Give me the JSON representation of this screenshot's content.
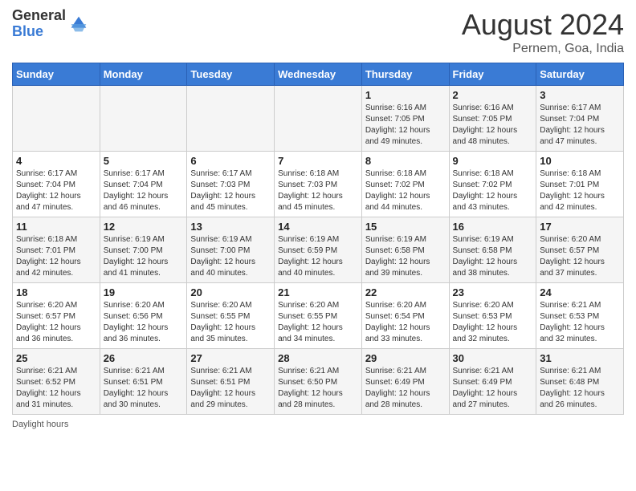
{
  "header": {
    "logo_general": "General",
    "logo_blue": "Blue",
    "main_title": "August 2024",
    "subtitle": "Pernem, Goa, India"
  },
  "days_of_week": [
    "Sunday",
    "Monday",
    "Tuesday",
    "Wednesday",
    "Thursday",
    "Friday",
    "Saturday"
  ],
  "footer": {
    "daylight_hours_label": "Daylight hours"
  },
  "weeks": [
    [
      {
        "day": "",
        "info": ""
      },
      {
        "day": "",
        "info": ""
      },
      {
        "day": "",
        "info": ""
      },
      {
        "day": "",
        "info": ""
      },
      {
        "day": "1",
        "info": "Sunrise: 6:16 AM\nSunset: 7:05 PM\nDaylight: 12 hours\nand 49 minutes."
      },
      {
        "day": "2",
        "info": "Sunrise: 6:16 AM\nSunset: 7:05 PM\nDaylight: 12 hours\nand 48 minutes."
      },
      {
        "day": "3",
        "info": "Sunrise: 6:17 AM\nSunset: 7:04 PM\nDaylight: 12 hours\nand 47 minutes."
      }
    ],
    [
      {
        "day": "4",
        "info": "Sunrise: 6:17 AM\nSunset: 7:04 PM\nDaylight: 12 hours\nand 47 minutes."
      },
      {
        "day": "5",
        "info": "Sunrise: 6:17 AM\nSunset: 7:04 PM\nDaylight: 12 hours\nand 46 minutes."
      },
      {
        "day": "6",
        "info": "Sunrise: 6:17 AM\nSunset: 7:03 PM\nDaylight: 12 hours\nand 45 minutes."
      },
      {
        "day": "7",
        "info": "Sunrise: 6:18 AM\nSunset: 7:03 PM\nDaylight: 12 hours\nand 45 minutes."
      },
      {
        "day": "8",
        "info": "Sunrise: 6:18 AM\nSunset: 7:02 PM\nDaylight: 12 hours\nand 44 minutes."
      },
      {
        "day": "9",
        "info": "Sunrise: 6:18 AM\nSunset: 7:02 PM\nDaylight: 12 hours\nand 43 minutes."
      },
      {
        "day": "10",
        "info": "Sunrise: 6:18 AM\nSunset: 7:01 PM\nDaylight: 12 hours\nand 42 minutes."
      }
    ],
    [
      {
        "day": "11",
        "info": "Sunrise: 6:18 AM\nSunset: 7:01 PM\nDaylight: 12 hours\nand 42 minutes."
      },
      {
        "day": "12",
        "info": "Sunrise: 6:19 AM\nSunset: 7:00 PM\nDaylight: 12 hours\nand 41 minutes."
      },
      {
        "day": "13",
        "info": "Sunrise: 6:19 AM\nSunset: 7:00 PM\nDaylight: 12 hours\nand 40 minutes."
      },
      {
        "day": "14",
        "info": "Sunrise: 6:19 AM\nSunset: 6:59 PM\nDaylight: 12 hours\nand 40 minutes."
      },
      {
        "day": "15",
        "info": "Sunrise: 6:19 AM\nSunset: 6:58 PM\nDaylight: 12 hours\nand 39 minutes."
      },
      {
        "day": "16",
        "info": "Sunrise: 6:19 AM\nSunset: 6:58 PM\nDaylight: 12 hours\nand 38 minutes."
      },
      {
        "day": "17",
        "info": "Sunrise: 6:20 AM\nSunset: 6:57 PM\nDaylight: 12 hours\nand 37 minutes."
      }
    ],
    [
      {
        "day": "18",
        "info": "Sunrise: 6:20 AM\nSunset: 6:57 PM\nDaylight: 12 hours\nand 36 minutes."
      },
      {
        "day": "19",
        "info": "Sunrise: 6:20 AM\nSunset: 6:56 PM\nDaylight: 12 hours\nand 36 minutes."
      },
      {
        "day": "20",
        "info": "Sunrise: 6:20 AM\nSunset: 6:55 PM\nDaylight: 12 hours\nand 35 minutes."
      },
      {
        "day": "21",
        "info": "Sunrise: 6:20 AM\nSunset: 6:55 PM\nDaylight: 12 hours\nand 34 minutes."
      },
      {
        "day": "22",
        "info": "Sunrise: 6:20 AM\nSunset: 6:54 PM\nDaylight: 12 hours\nand 33 minutes."
      },
      {
        "day": "23",
        "info": "Sunrise: 6:20 AM\nSunset: 6:53 PM\nDaylight: 12 hours\nand 32 minutes."
      },
      {
        "day": "24",
        "info": "Sunrise: 6:21 AM\nSunset: 6:53 PM\nDaylight: 12 hours\nand 32 minutes."
      }
    ],
    [
      {
        "day": "25",
        "info": "Sunrise: 6:21 AM\nSunset: 6:52 PM\nDaylight: 12 hours\nand 31 minutes."
      },
      {
        "day": "26",
        "info": "Sunrise: 6:21 AM\nSunset: 6:51 PM\nDaylight: 12 hours\nand 30 minutes."
      },
      {
        "day": "27",
        "info": "Sunrise: 6:21 AM\nSunset: 6:51 PM\nDaylight: 12 hours\nand 29 minutes."
      },
      {
        "day": "28",
        "info": "Sunrise: 6:21 AM\nSunset: 6:50 PM\nDaylight: 12 hours\nand 28 minutes."
      },
      {
        "day": "29",
        "info": "Sunrise: 6:21 AM\nSunset: 6:49 PM\nDaylight: 12 hours\nand 28 minutes."
      },
      {
        "day": "30",
        "info": "Sunrise: 6:21 AM\nSunset: 6:49 PM\nDaylight: 12 hours\nand 27 minutes."
      },
      {
        "day": "31",
        "info": "Sunrise: 6:21 AM\nSunset: 6:48 PM\nDaylight: 12 hours\nand 26 minutes."
      }
    ]
  ]
}
